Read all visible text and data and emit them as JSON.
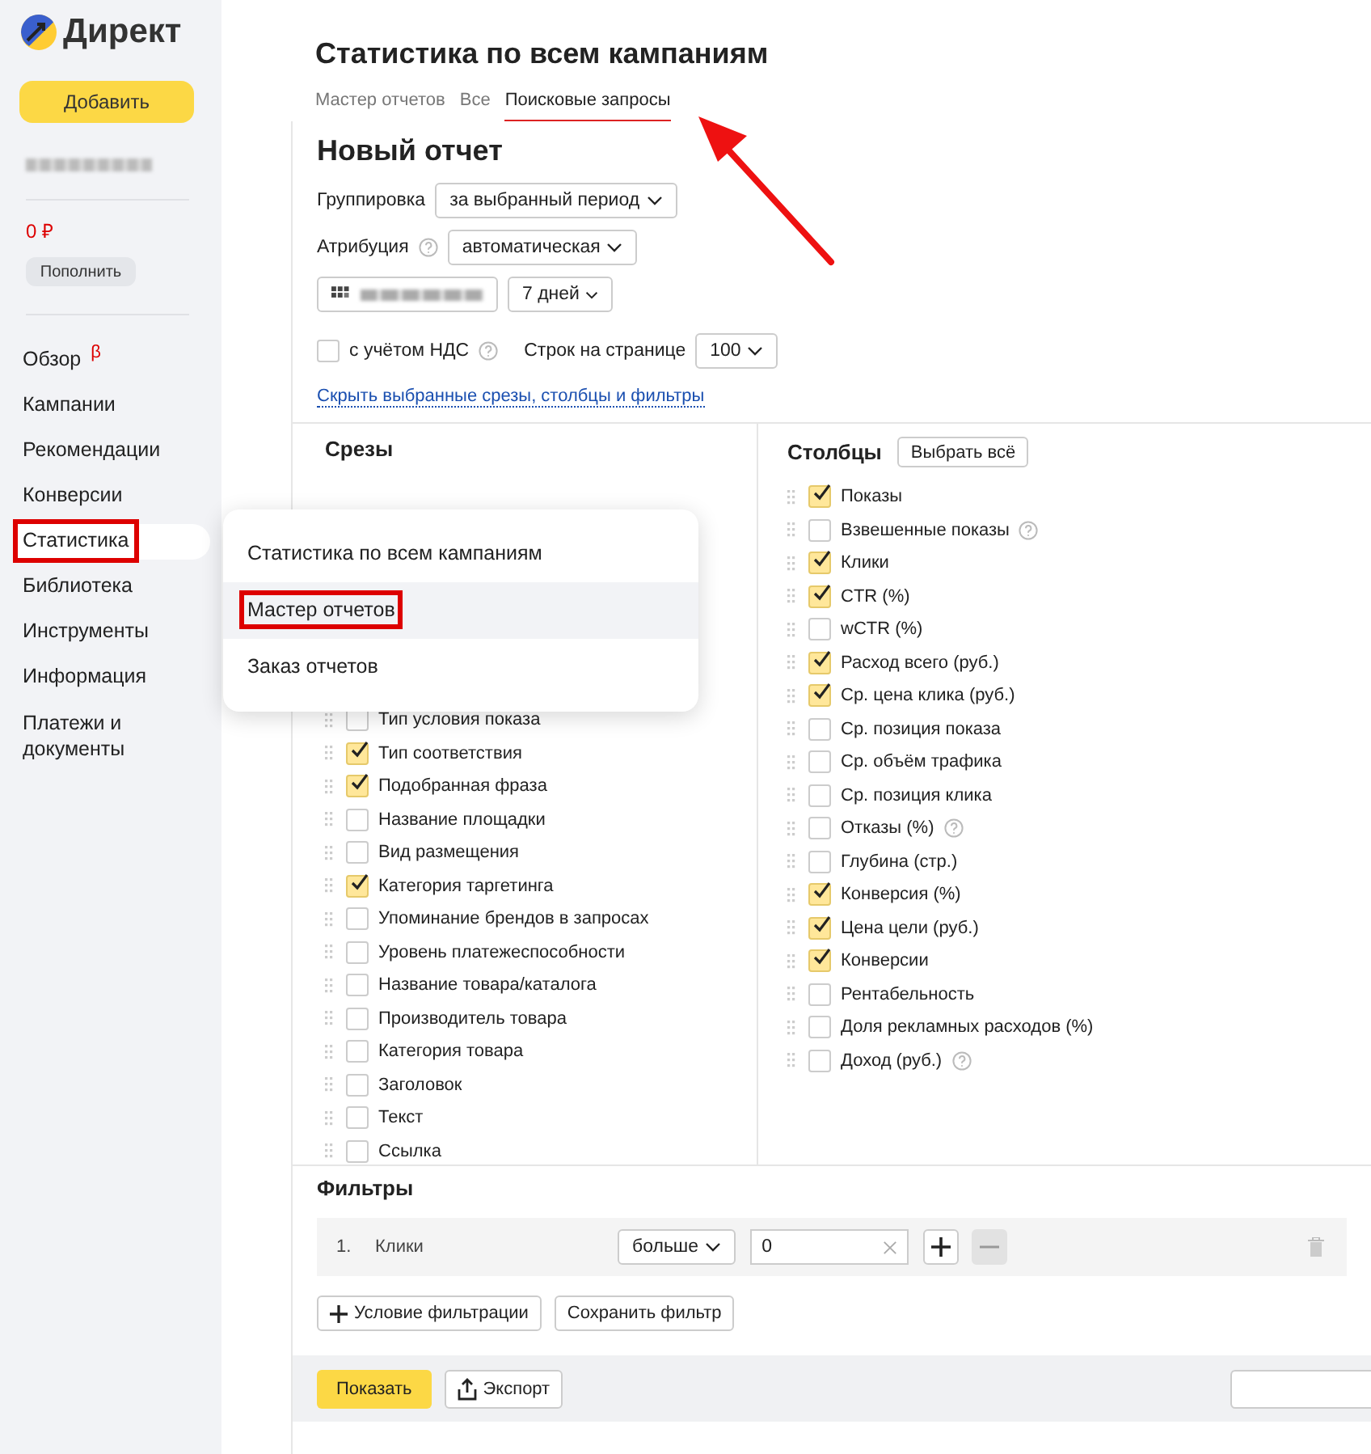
{
  "logo": {
    "text": "Директ"
  },
  "sidebar": {
    "add_button": "Добавить",
    "balance": "0 ₽",
    "topup_button": "Пополнить",
    "items": [
      {
        "label": "Обзор",
        "badge": "β",
        "selected": false,
        "outlined": false
      },
      {
        "label": "Кампании",
        "selected": false,
        "outlined": false
      },
      {
        "label": "Рекомендации",
        "selected": false,
        "outlined": false
      },
      {
        "label": "Конверсии",
        "selected": false,
        "outlined": false
      },
      {
        "label": "Статистика",
        "selected": true,
        "outlined": true
      },
      {
        "label": "Библиотека",
        "selected": false,
        "outlined": false
      },
      {
        "label": "Инструменты",
        "selected": false,
        "outlined": false
      },
      {
        "label": "Информация",
        "selected": false,
        "outlined": false
      },
      {
        "label": "Платежи и документы",
        "selected": false,
        "outlined": false
      }
    ]
  },
  "page_title": "Статистика по всем кампаниям",
  "tabs": [
    {
      "label": "Мастер отчетов",
      "selected": false
    },
    {
      "label": "Все",
      "selected": false
    },
    {
      "label": "Поисковые запросы",
      "selected": true
    }
  ],
  "report": {
    "title": "Новый отчет",
    "grouping": {
      "label": "Группировка",
      "value": "за выбранный период"
    },
    "attribution": {
      "label": "Атрибуция",
      "value": "автоматическая"
    },
    "period": "7 дней",
    "vat": {
      "label": "с учётом НДС",
      "checked": false
    },
    "rows_per_page": {
      "label": "Строк на странице",
      "value": "100"
    },
    "hide_link": "Скрыть выбранные срезы, столбцы и фильтры"
  },
  "slices": {
    "title": "Срезы",
    "items": [
      {
        "label": "Тип условия показа",
        "checked": false
      },
      {
        "label": "Тип соответствия",
        "checked": true
      },
      {
        "label": "Подобранная фраза",
        "checked": true
      },
      {
        "label": "Название площадки",
        "checked": false
      },
      {
        "label": "Вид размещения",
        "checked": false
      },
      {
        "label": "Категория таргетинга",
        "checked": true
      },
      {
        "label": "Упоминание брендов в запросах",
        "checked": false
      },
      {
        "label": "Уровень платежеспособности",
        "checked": false
      },
      {
        "label": "Название товара/каталога",
        "checked": false
      },
      {
        "label": "Производитель товара",
        "checked": false
      },
      {
        "label": "Категория товара",
        "checked": false
      },
      {
        "label": "Заголовок",
        "checked": false
      },
      {
        "label": "Текст",
        "checked": false
      },
      {
        "label": "Ссылка",
        "checked": false
      }
    ]
  },
  "columns": {
    "title": "Столбцы",
    "select_all": "Выбрать всё",
    "items": [
      {
        "label": "Показы",
        "checked": true,
        "help": false
      },
      {
        "label": "Взвешенные показы",
        "checked": false,
        "help": true
      },
      {
        "label": "Клики",
        "checked": true,
        "help": false
      },
      {
        "label": "CTR (%)",
        "checked": true,
        "help": false
      },
      {
        "label": "wCTR (%)",
        "checked": false,
        "help": false
      },
      {
        "label": "Расход всего (руб.)",
        "checked": true,
        "help": false
      },
      {
        "label": "Ср. цена клика (руб.)",
        "checked": true,
        "help": false
      },
      {
        "label": "Ср. позиция показа",
        "checked": false,
        "help": false
      },
      {
        "label": "Ср. объём трафика",
        "checked": false,
        "help": false
      },
      {
        "label": "Ср. позиция клика",
        "checked": false,
        "help": false
      },
      {
        "label": "Отказы (%)",
        "checked": false,
        "help": true
      },
      {
        "label": "Глубина (стр.)",
        "checked": false,
        "help": false
      },
      {
        "label": "Конверсия (%)",
        "checked": true,
        "help": false
      },
      {
        "label": "Цена цели (руб.)",
        "checked": true,
        "help": false
      },
      {
        "label": "Конверсии",
        "checked": true,
        "help": false
      },
      {
        "label": "Рентабельность",
        "checked": false,
        "help": false
      },
      {
        "label": "Доля рекламных расходов (%)",
        "checked": false,
        "help": false
      },
      {
        "label": "Доход (руб.)",
        "checked": false,
        "help": true
      }
    ]
  },
  "filters": {
    "title": "Фильтры",
    "rows": [
      {
        "number": "1.",
        "field": "Клики",
        "operator": "больше",
        "value": "0"
      }
    ],
    "add_condition": "Условие фильтрации",
    "save_filter": "Сохранить фильтр"
  },
  "footer": {
    "show": "Показать",
    "export": "Экспорт"
  },
  "menu": {
    "items": [
      {
        "label": "Статистика по всем кампаниям",
        "selected": false,
        "outlined": false
      },
      {
        "label": "Мастер отчетов",
        "selected": true,
        "outlined": true
      },
      {
        "label": "Заказ отчетов",
        "selected": false,
        "outlined": false
      }
    ]
  }
}
